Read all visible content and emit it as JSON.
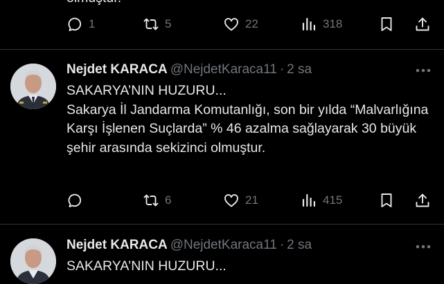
{
  "colors": {
    "background": "#000000",
    "text": "#e7e9ea",
    "muted": "#71767b",
    "divider": "#2f3336"
  },
  "top_tweet": {
    "body_tail": "olmuştur.",
    "replies": "1",
    "retweets": "5",
    "likes": "22",
    "views": "318"
  },
  "tweet_main": {
    "display_name": "Nejdet KARACA",
    "handle": "@NejdetKaraca11",
    "separator": "·",
    "time": "2 sa",
    "body": "SAKARYA’NIN HUZURU...\nSakarya İl Jandarma Komutanlığı, son bir yılda “Malvarlığına Karşı İşlenen Suçlarda” % 46 azalma sağlayarak 30 büyük şehir arasında sekizinci olmuştur.",
    "replies": "",
    "retweets": "6",
    "likes": "21",
    "views": "415"
  },
  "tweet_bottom": {
    "display_name": "Nejdet KARACA",
    "handle": "@NejdetKaraca11",
    "separator": "·",
    "time": "2 sa",
    "body_head": "SAKARYA’NIN HUZURU..."
  },
  "icons": {
    "reply": "reply-icon",
    "retweet": "retweet-icon",
    "like": "heart-icon",
    "views": "views-icon",
    "bookmark": "bookmark-icon",
    "share": "share-icon",
    "more": "more-icon"
  }
}
